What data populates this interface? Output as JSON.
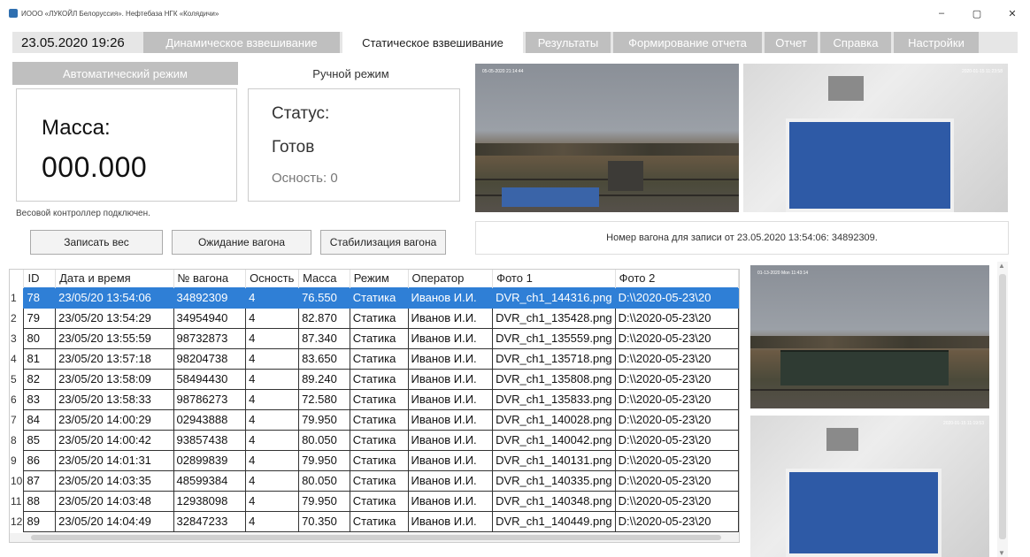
{
  "window": {
    "title": "ИООО «ЛУКОЙЛ Белоруссия». Нефтебаза НГК «Колядичи»",
    "minimize": "–",
    "maximize": "▢",
    "close": "✕"
  },
  "header": {
    "datetime": "23.05.2020 19:26",
    "tabs": [
      {
        "label": "Динамическое взвешивание",
        "active": false
      },
      {
        "label": "Статическое взвешивание",
        "active": true
      },
      {
        "label": "Результаты",
        "active": false
      },
      {
        "label": "Формирование отчета",
        "active": false
      },
      {
        "label": "Отчет",
        "active": false
      },
      {
        "label": "Справка",
        "active": false
      },
      {
        "label": "Настройки",
        "active": false
      }
    ]
  },
  "modes": {
    "auto": "Автоматический режим",
    "manual": "Ручной режим"
  },
  "mass": {
    "label": "Масса:",
    "value": "000.000"
  },
  "status": {
    "label": "Статус:",
    "value": "Готов",
    "axles": "Осность: 0"
  },
  "controller_status": "Весовой контроллер подключен.",
  "buttons": {
    "record": "Записать вес",
    "wait": "Ожидание вагона",
    "stabilize": "Стабилизация вагона"
  },
  "cameras": {
    "cam1_ts": "05-05-2020 21:14:44",
    "cam2_ts": "2020-01-15 11:23:58",
    "cam3_ts": "01-13-2020 Mon 11:43:14",
    "cam4_ts": "2020-01-15 11:19:53"
  },
  "record_info": "Номер вагона для записи от 23.05.2020 13:54:06: 34892309.",
  "table": {
    "columns": [
      "ID",
      "Дата и время",
      "№ вагона",
      "Осность",
      "Масса",
      "Режим",
      "Оператор",
      "Фото 1",
      "Фото 2"
    ],
    "rows": [
      {
        "n": "1",
        "id": "78",
        "dt": "23/05/20 13:54:06",
        "wagon": "34892309",
        "axles": "4",
        "mass": "76.550",
        "mode": "Статика",
        "op": "Иванов И.И.",
        "f1": "DVR_ch1_144316.png",
        "f2": "D:\\\\2020-05-23\\20"
      },
      {
        "n": "2",
        "id": "79",
        "dt": "23/05/20 13:54:29",
        "wagon": "34954940",
        "axles": "4",
        "mass": "82.870",
        "mode": "Статика",
        "op": "Иванов И.И.",
        "f1": "DVR_ch1_135428.png",
        "f2": "D:\\\\2020-05-23\\20"
      },
      {
        "n": "3",
        "id": "80",
        "dt": "23/05/20 13:55:59",
        "wagon": "98732873",
        "axles": "4",
        "mass": "87.340",
        "mode": "Статика",
        "op": "Иванов И.И.",
        "f1": "DVR_ch1_135559.png",
        "f2": "D:\\\\2020-05-23\\20"
      },
      {
        "n": "4",
        "id": "81",
        "dt": "23/05/20 13:57:18",
        "wagon": "98204738",
        "axles": "4",
        "mass": "83.650",
        "mode": "Статика",
        "op": "Иванов И.И.",
        "f1": "DVR_ch1_135718.png",
        "f2": "D:\\\\2020-05-23\\20"
      },
      {
        "n": "5",
        "id": "82",
        "dt": "23/05/20 13:58:09",
        "wagon": "58494430",
        "axles": "4",
        "mass": "89.240",
        "mode": "Статика",
        "op": "Иванов И.И.",
        "f1": "DVR_ch1_135808.png",
        "f2": "D:\\\\2020-05-23\\20"
      },
      {
        "n": "6",
        "id": "83",
        "dt": "23/05/20 13:58:33",
        "wagon": "98786273",
        "axles": "4",
        "mass": "72.580",
        "mode": "Статика",
        "op": "Иванов И.И.",
        "f1": "DVR_ch1_135833.png",
        "f2": "D:\\\\2020-05-23\\20"
      },
      {
        "n": "7",
        "id": "84",
        "dt": "23/05/20 14:00:29",
        "wagon": "02943888",
        "axles": "4",
        "mass": "79.950",
        "mode": "Статика",
        "op": "Иванов И.И.",
        "f1": "DVR_ch1_140028.png",
        "f2": "D:\\\\2020-05-23\\20"
      },
      {
        "n": "8",
        "id": "85",
        "dt": "23/05/20 14:00:42",
        "wagon": "93857438",
        "axles": "4",
        "mass": "80.050",
        "mode": "Статика",
        "op": "Иванов И.И.",
        "f1": "DVR_ch1_140042.png",
        "f2": "D:\\\\2020-05-23\\20"
      },
      {
        "n": "9",
        "id": "86",
        "dt": "23/05/20 14:01:31",
        "wagon": "02899839",
        "axles": "4",
        "mass": "79.950",
        "mode": "Статика",
        "op": "Иванов И.И.",
        "f1": "DVR_ch1_140131.png",
        "f2": "D:\\\\2020-05-23\\20"
      },
      {
        "n": "10",
        "id": "87",
        "dt": "23/05/20 14:03:35",
        "wagon": "48599384",
        "axles": "4",
        "mass": "80.050",
        "mode": "Статика",
        "op": "Иванов И.И.",
        "f1": "DVR_ch1_140335.png",
        "f2": "D:\\\\2020-05-23\\20"
      },
      {
        "n": "11",
        "id": "88",
        "dt": "23/05/20 14:03:48",
        "wagon": "12938098",
        "axles": "4",
        "mass": "79.950",
        "mode": "Статика",
        "op": "Иванов И.И.",
        "f1": "DVR_ch1_140348.png",
        "f2": "D:\\\\2020-05-23\\20"
      },
      {
        "n": "12",
        "id": "89",
        "dt": "23/05/20 14:04:49",
        "wagon": "32847233",
        "axles": "4",
        "mass": "70.350",
        "mode": "Статика",
        "op": "Иванов И.И.",
        "f1": "DVR_ch1_140449.png",
        "f2": "D:\\\\2020-05-23\\20"
      }
    ]
  },
  "colors": {
    "selected_row": "#2f7fd6",
    "inactive_tab": "#bfbfbf"
  }
}
